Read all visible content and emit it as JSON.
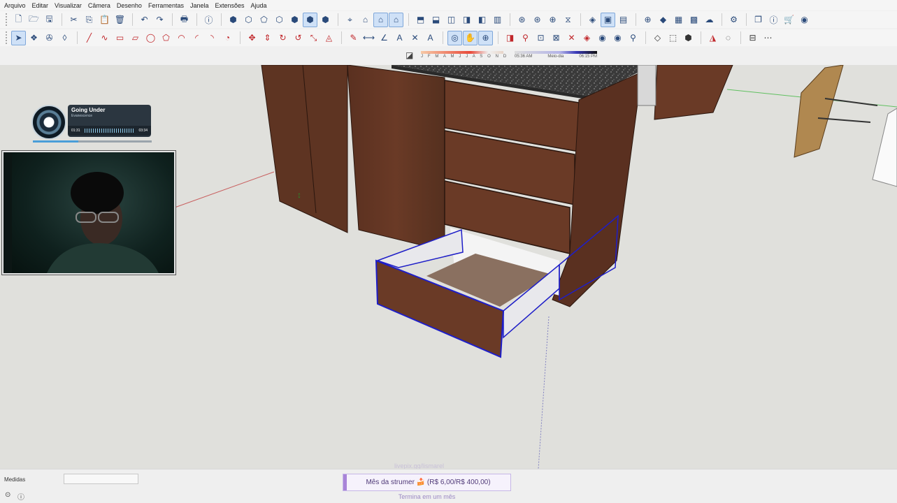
{
  "menu": [
    "Arquivo",
    "Editar",
    "Visualizar",
    "Câmera",
    "Desenho",
    "Ferramentas",
    "Janela",
    "Extensões",
    "Ajuda"
  ],
  "toolbar_row1": [
    {
      "icon": "new-file-icon",
      "g": "🗋"
    },
    {
      "icon": "open-folder-icon",
      "g": "🗁"
    },
    {
      "icon": "save-icon",
      "g": "🖫"
    },
    {
      "sep": true
    },
    {
      "icon": "cut-icon",
      "g": "✂"
    },
    {
      "icon": "copy-icon",
      "g": "⎘"
    },
    {
      "icon": "paste-icon",
      "g": "📋"
    },
    {
      "icon": "delete-icon",
      "g": "🗑"
    },
    {
      "sep": true
    },
    {
      "icon": "undo-icon",
      "g": "↶"
    },
    {
      "icon": "redo-icon",
      "g": "↷"
    },
    {
      "sep": true
    },
    {
      "icon": "print-icon",
      "g": "🖶"
    },
    {
      "sep": true
    },
    {
      "icon": "model-info-icon",
      "g": "ⓘ"
    },
    {
      "sep": true
    },
    {
      "icon": "xray-icon",
      "g": "⬢"
    },
    {
      "icon": "back-edges-icon",
      "g": "⬡"
    },
    {
      "icon": "wireframe-icon",
      "g": "⬠"
    },
    {
      "icon": "hidden-line-icon",
      "g": "⬡"
    },
    {
      "icon": "shaded-icon",
      "g": "⬢"
    },
    {
      "icon": "shaded-textures-icon",
      "g": "⬢",
      "active": true
    },
    {
      "icon": "monochrome-icon",
      "g": "⬢"
    },
    {
      "sep": true
    },
    {
      "icon": "iso-view-icon",
      "g": "⌖"
    },
    {
      "icon": "top-view-icon",
      "g": "⌂"
    },
    {
      "icon": "front-view-icon",
      "g": "⌂",
      "active": true
    },
    {
      "icon": "right-view-icon",
      "g": "⌂",
      "active": true
    },
    {
      "sep": true
    },
    {
      "icon": "back-view-icon",
      "g": "⬒"
    },
    {
      "icon": "left-view-icon",
      "g": "⬓"
    },
    {
      "icon": "section-plane-icon",
      "g": "◫"
    },
    {
      "icon": "section-cut-icon",
      "g": "◨"
    },
    {
      "icon": "section-fill-icon",
      "g": "◧"
    },
    {
      "icon": "display-sections-icon",
      "g": "▥"
    },
    {
      "sep": true
    },
    {
      "icon": "warehouse-icon",
      "g": "⊛"
    },
    {
      "icon": "extension-warehouse-icon",
      "g": "⊛"
    },
    {
      "icon": "share-model-icon",
      "g": "⊕"
    },
    {
      "icon": "layout-icon",
      "g": "⧖"
    },
    {
      "sep": true
    },
    {
      "icon": "component-icon",
      "g": "◈"
    },
    {
      "icon": "group-icon",
      "g": "▣",
      "active": true
    },
    {
      "icon": "scene-icon",
      "g": "▤"
    },
    {
      "sep": true
    },
    {
      "icon": "add-location-icon",
      "g": "⊕"
    },
    {
      "icon": "terrain-icon",
      "g": "◆"
    },
    {
      "icon": "photo-texture-icon",
      "g": "▦"
    },
    {
      "icon": "checker-icon",
      "g": "▩"
    },
    {
      "icon": "cloud-icon",
      "g": "☁"
    },
    {
      "sep": true
    },
    {
      "icon": "settings-icon",
      "g": "⚙"
    },
    {
      "sep": true
    },
    {
      "icon": "windows-icon",
      "g": "❐"
    },
    {
      "icon": "instructor-icon",
      "g": "ⓘ"
    },
    {
      "icon": "cart-icon",
      "g": "🛒"
    },
    {
      "icon": "account-icon",
      "g": "◉"
    }
  ],
  "toolbar_row2": [
    {
      "icon": "select-icon",
      "g": "➤",
      "active": true
    },
    {
      "icon": "make-component-icon",
      "g": "❖"
    },
    {
      "icon": "paint-bucket-icon",
      "g": "✇"
    },
    {
      "icon": "eraser-icon",
      "g": "◊"
    },
    {
      "sep": true
    },
    {
      "icon": "line-icon",
      "g": "╱",
      "red": true
    },
    {
      "icon": "freehand-icon",
      "g": "∿",
      "red": true
    },
    {
      "icon": "rectangle-icon",
      "g": "▭",
      "red": true
    },
    {
      "icon": "rotated-rectangle-icon",
      "g": "▱",
      "red": true
    },
    {
      "icon": "circle-icon",
      "g": "◯",
      "red": true
    },
    {
      "icon": "polygon-icon",
      "g": "⬠",
      "red": true
    },
    {
      "icon": "arc-icon",
      "g": "◠",
      "red": true
    },
    {
      "icon": "two-point-arc-icon",
      "g": "◜",
      "red": true
    },
    {
      "icon": "three-point-arc-icon",
      "g": "◝",
      "red": true
    },
    {
      "icon": "pie-icon",
      "g": "◔",
      "red": true
    },
    {
      "sep": true
    },
    {
      "icon": "move-icon",
      "g": "✥",
      "red": true
    },
    {
      "icon": "push-pull-icon",
      "g": "⇕",
      "red": true
    },
    {
      "icon": "rotate-icon",
      "g": "↻",
      "red": true
    },
    {
      "icon": "follow-me-icon",
      "g": "↺",
      "red": true
    },
    {
      "icon": "scale-icon",
      "g": "⤡",
      "red": true
    },
    {
      "icon": "offset-icon",
      "g": "◬",
      "red": true
    },
    {
      "sep": true
    },
    {
      "icon": "tape-measure-icon",
      "g": "✎",
      "red": true
    },
    {
      "icon": "dimension-icon",
      "g": "⟷"
    },
    {
      "icon": "protractor-icon",
      "g": "∠"
    },
    {
      "icon": "text-icon",
      "g": "A"
    },
    {
      "icon": "axes-icon",
      "g": "✕"
    },
    {
      "icon": "3d-text-icon",
      "g": "A"
    },
    {
      "sep": true
    },
    {
      "icon": "orbit-icon",
      "g": "◎",
      "active": true
    },
    {
      "icon": "pan-icon",
      "g": "✋",
      "active": true
    },
    {
      "icon": "zoom-icon",
      "g": "⊕",
      "active": true
    },
    {
      "sep": true
    },
    {
      "icon": "section-plane-2-icon",
      "g": "◨",
      "red": true
    },
    {
      "icon": "walk-icon",
      "g": "⚲",
      "red": true
    },
    {
      "icon": "zoom-window-icon",
      "g": "⊡"
    },
    {
      "icon": "zoom-extents-icon",
      "g": "⊠"
    },
    {
      "icon": "previous-view-icon",
      "g": "✕",
      "red": true
    },
    {
      "icon": "position-camera-icon",
      "g": "◈",
      "red": true
    },
    {
      "icon": "look-around-icon",
      "g": "◉"
    },
    {
      "icon": "eye-icon",
      "g": "◉"
    },
    {
      "icon": "walk-person-icon",
      "g": "⚲"
    },
    {
      "sep": true
    },
    {
      "icon": "sandbox-icon",
      "g": "◇",
      "dark": true
    },
    {
      "icon": "cube-icon",
      "g": "⬚",
      "dark": true
    },
    {
      "icon": "solid-tools-icon",
      "g": "⬢",
      "dark": true
    },
    {
      "sep": true
    },
    {
      "icon": "mirror-icon",
      "g": "◮",
      "red": true
    },
    {
      "icon": "round-corner-icon",
      "g": "◌",
      "dark": true
    },
    {
      "sep": true
    },
    {
      "icon": "dimension-tools-icon",
      "g": "⊟",
      "dark": true
    },
    {
      "icon": "grid-icon",
      "g": "⋯",
      "dark": true
    }
  ],
  "shadows": {
    "icon": "shadow-toggle-icon",
    "months": "J F M A M J J A S O N D",
    "time_start": "05:36 AM",
    "time_mid": "Meio-dia",
    "time_end": "06:15 PM"
  },
  "music": {
    "song": "Going Under",
    "artist": "Evanescence",
    "elapsed": "01:31",
    "duration": "03:34"
  },
  "status": {
    "measure_label": "Medidas",
    "measure_value": "",
    "geo_icon": "geo-location-icon",
    "info_icon": "info-icon"
  },
  "subgoal": {
    "label": "Mês da strumer 🍰 (R$ 6,00/R$ 400,00)",
    "subtitle": "Termina em um mês",
    "url": "livepix.gg/lismarel"
  }
}
